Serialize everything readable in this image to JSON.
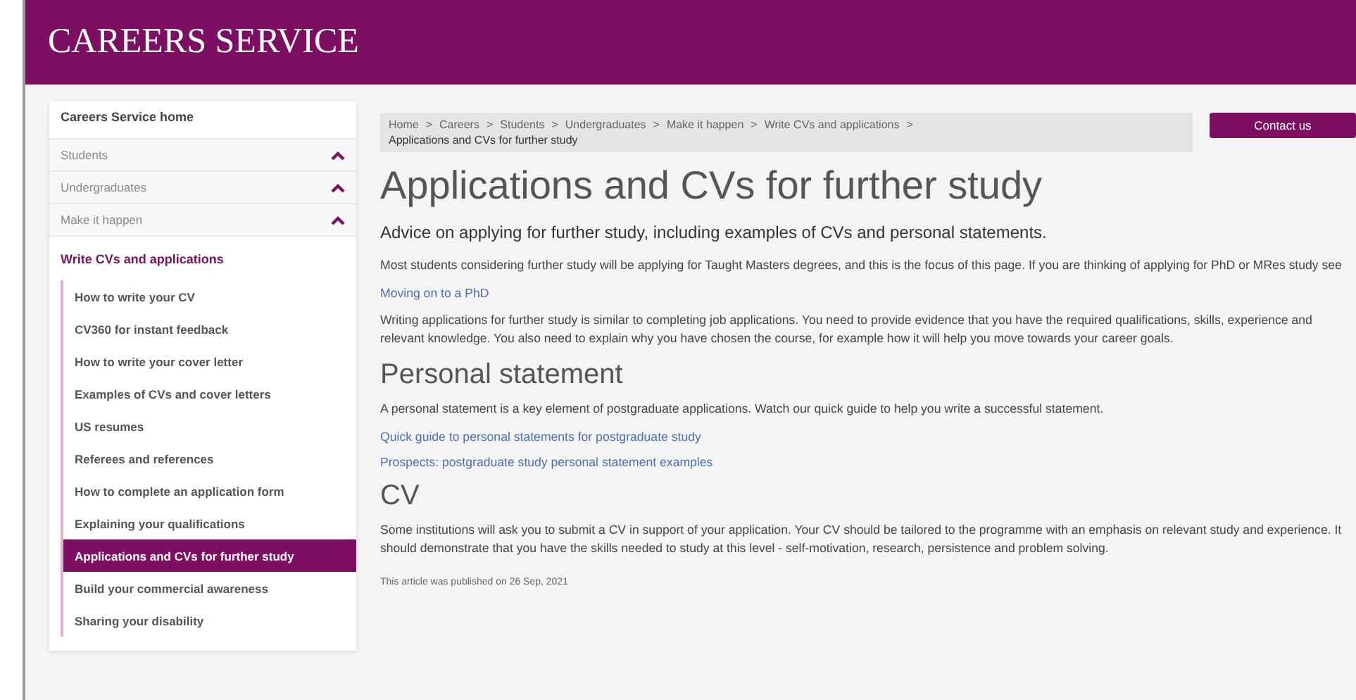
{
  "header": {
    "title": "CAREERS SERVICE"
  },
  "sidebar": {
    "home": "Careers Service home",
    "parents": [
      {
        "label": "Students",
        "expanded": true
      },
      {
        "label": "Undergraduates",
        "expanded": true
      },
      {
        "label": "Make it happen",
        "expanded": true
      }
    ],
    "section": "Write CVs and applications",
    "items": [
      {
        "label": "How to write your CV",
        "selected": false
      },
      {
        "label": "CV360 for instant feedback",
        "selected": false
      },
      {
        "label": "How to write your cover letter",
        "selected": false
      },
      {
        "label": "Examples of CVs and cover letters",
        "selected": false
      },
      {
        "label": "US resumes",
        "selected": false
      },
      {
        "label": "Referees and references",
        "selected": false
      },
      {
        "label": "How to complete an application form",
        "selected": false
      },
      {
        "label": "Explaining your qualifications",
        "selected": false
      },
      {
        "label": "Applications and CVs for further study",
        "selected": true
      },
      {
        "label": "Build your commercial awareness",
        "selected": false
      },
      {
        "label": "Sharing your disability",
        "selected": false
      }
    ]
  },
  "breadcrumb": {
    "separator": ">",
    "items": [
      "Home",
      "Careers",
      "Students",
      "Undergraduates",
      "Make it happen",
      "Write CVs and applications",
      "Applications and CVs for further study"
    ]
  },
  "contact_button": "Contact us",
  "title": "Applications and CVs for further study",
  "lead": "Advice on applying for further study, including examples of CVs and personal statements.",
  "content": [
    {
      "kind": "paragraph",
      "text": "Most students considering further study will be applying for Taught Masters degrees, and this is the focus of this page. If you are thinking of applying for PhD or MRes study see"
    },
    {
      "kind": "link",
      "text": "Moving on to a PhD"
    },
    {
      "kind": "paragraph",
      "text": "Writing applications for further study is similar to completing job applications. You need to provide evidence that you have the required qualifications, skills, experience and relevant knowledge. You also need to explain why you have chosen the course, for example how it will help you move towards your career goals."
    },
    {
      "kind": "heading",
      "text": "Personal statement"
    },
    {
      "kind": "paragraph",
      "text": "A personal statement is a key element of postgraduate applications.  Watch our quick guide to help you write a successful statement."
    },
    {
      "kind": "link",
      "text": "Quick guide to personal statements for postgraduate study"
    },
    {
      "kind": "link",
      "text": "Prospects: postgraduate study personal statement examples"
    },
    {
      "kind": "heading",
      "text": "CV"
    },
    {
      "kind": "paragraph",
      "text": "Some institutions will ask you to submit a CV in support of your application.  Your CV should be tailored to the programme with an emphasis on relevant study and experience. It should demonstrate that you have the skills needed to study at this level - self-motivation, research, persistence and problem solving."
    }
  ],
  "published": "This article was published on 26 Sep, 2021"
}
